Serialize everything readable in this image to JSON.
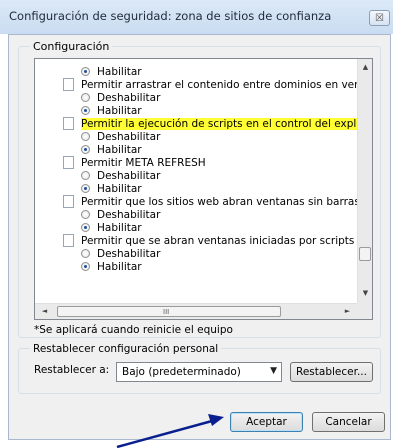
{
  "window": {
    "title": "Configuración de seguridad: zona de sitios de confianza",
    "close_glyph": "☒"
  },
  "settings_group": {
    "label": "Configuración"
  },
  "settings_list": [
    {
      "kind": "option",
      "label": "Habilitar",
      "selected": true
    },
    {
      "kind": "category",
      "label": "Permitir arrastrar el contenido entre dominios en ventanas se"
    },
    {
      "kind": "option",
      "label": "Deshabilitar",
      "selected": false
    },
    {
      "kind": "option",
      "label": "Habilitar",
      "selected": true
    },
    {
      "kind": "category",
      "label": "Permitir la ejecución de scripts en el control del explorador we",
      "highlighted": true
    },
    {
      "kind": "option",
      "label": "Deshabilitar",
      "selected": false
    },
    {
      "kind": "option",
      "label": "Habilitar",
      "selected": true
    },
    {
      "kind": "category",
      "label": "Permitir META REFRESH"
    },
    {
      "kind": "option",
      "label": "Deshabilitar",
      "selected": false
    },
    {
      "kind": "option",
      "label": "Habilitar",
      "selected": true
    },
    {
      "kind": "category",
      "label": "Permitir que los sitios web abran ventanas sin barras de direc"
    },
    {
      "kind": "option",
      "label": "Deshabilitar",
      "selected": false
    },
    {
      "kind": "option",
      "label": "Habilitar",
      "selected": true
    },
    {
      "kind": "category",
      "label": "Permitir que se abran ventanas iniciadas por scripts sin ningu"
    },
    {
      "kind": "option",
      "label": "Deshabilitar",
      "selected": false
    },
    {
      "kind": "option",
      "label": "Habilitar",
      "selected": true
    }
  ],
  "scroll": {
    "up": "▲",
    "down": "▼",
    "left": "◄",
    "right": "►",
    "grip": "III"
  },
  "highlight_color": "#ffff33",
  "note": "*Se aplicará cuando reinicie el equipo",
  "reset_group": {
    "label": "Restablecer configuración personal",
    "reset_to_label": "Restablecer a:",
    "select_value": "Bajo (predeterminado)",
    "select_arrow": "▼",
    "reset_button": "Restablecer..."
  },
  "buttons": {
    "ok": "Aceptar",
    "cancel": "Cancelar"
  },
  "annotation": {
    "arrow_color": "#0a1f8f"
  }
}
